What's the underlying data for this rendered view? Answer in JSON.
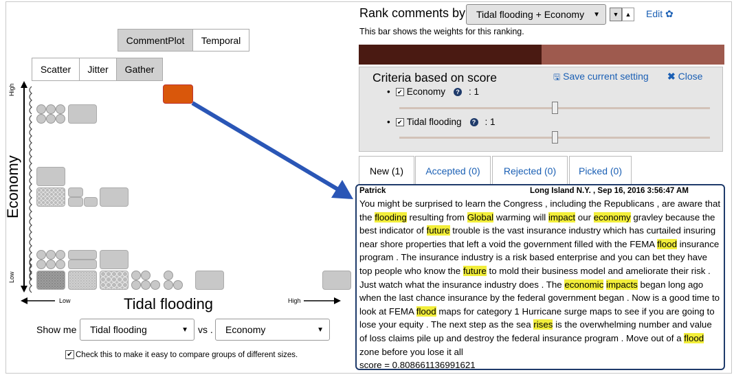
{
  "view_toggle": {
    "commentplot": "CommentPlot",
    "temporal": "Temporal"
  },
  "layout_toggle": {
    "scatter": "Scatter",
    "jitter": "Jitter",
    "gather": "Gather"
  },
  "plot": {
    "y_axis_label": "Economy",
    "x_axis_label": "Tidal flooding",
    "y_high": "High",
    "y_low": "Low",
    "x_low": "Low",
    "x_high": "High"
  },
  "controls": {
    "show_me_label": "Show me",
    "x_select_value": "Tidal flooding",
    "vs_label": "vs .",
    "y_select_value": "Economy",
    "compare_checkbox_label": "Check this to make it easy to compare groups of different sizes.",
    "compare_checked": true
  },
  "rank": {
    "label": "Rank comments by",
    "select_value": "Tidal flooding + Economy",
    "edit_label": "Edit",
    "weights_caption": "This bar shows the weights for this ranking.",
    "weights": [
      {
        "name": "Economy",
        "fraction": 0.5,
        "color": "#4a1a12"
      },
      {
        "name": "Tidal flooding",
        "fraction": 0.5,
        "color": "#9e5a4e"
      }
    ]
  },
  "criteria": {
    "title": "Criteria based on score",
    "save_label": "Save current setting",
    "close_label": "Close",
    "items": [
      {
        "name": "Economy",
        "checked": true,
        "value": ": 1",
        "slider_level": 0.5
      },
      {
        "name": "Tidal flooding",
        "checked": true,
        "value": ": 1",
        "slider_level": 0.5
      }
    ]
  },
  "tabs": [
    {
      "label": "New (1)",
      "active": true
    },
    {
      "label": "Accepted (0)",
      "active": false
    },
    {
      "label": "Rejected (0)",
      "active": false
    },
    {
      "label": "Picked (0)",
      "active": false
    }
  ],
  "comment": {
    "author": "Patrick",
    "meta": "Long Island N.Y. , Sep 16, 2016 3:56:47 AM",
    "segments": [
      {
        "t": "You might be surprised to learn the Congress , including the Republicans , are aware that the "
      },
      {
        "t": "flooding",
        "hl": true
      },
      {
        "t": " resulting from "
      },
      {
        "t": "Global",
        "hl": true
      },
      {
        "t": " warming will "
      },
      {
        "t": "impact",
        "hl": true
      },
      {
        "t": " our "
      },
      {
        "t": "economy",
        "hl": true
      },
      {
        "t": " gravley because the best indicator of "
      },
      {
        "t": "future",
        "hl": true
      },
      {
        "t": " trouble is the vast insurance industry which has curtailed insuring near shore properties that left a void the government filled with the FEMA "
      },
      {
        "t": "flood",
        "hl": true
      },
      {
        "t": " insurance program . The insurance industry is a risk based enterprise and you can bet they have top people who know the "
      },
      {
        "t": "future",
        "hl": true
      },
      {
        "t": " to mold their business model and ameliorate their risk . Just watch what the insurance industry does . The "
      },
      {
        "t": "economic",
        "hl": true
      },
      {
        "t": " "
      },
      {
        "t": "impacts",
        "hl": true
      },
      {
        "t": " began long ago when the last chance insurance by the federal government began . Now is a good time to look at FEMA "
      },
      {
        "t": "flood",
        "hl": true
      },
      {
        "t": " maps for category 1 Hurricane surge maps to see if you are going to lose your equity . The next step as the sea "
      },
      {
        "t": "rises",
        "hl": true
      },
      {
        "t": " is the overwhelming number and value of loss claims pile up and destroy the federal insurance program . Move out of a "
      },
      {
        "t": "flood",
        "hl": true
      },
      {
        "t": " zone before you lose it all"
      }
    ],
    "score": "score = 0.808661136991621"
  }
}
